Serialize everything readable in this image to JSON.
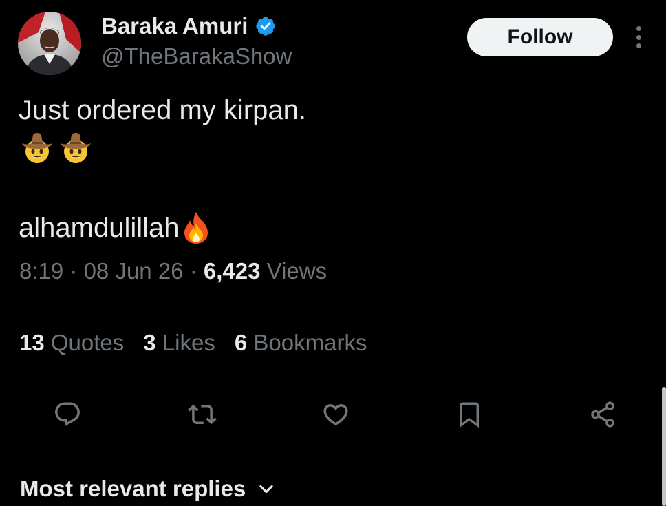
{
  "author": {
    "display_name": "Baraka Amuri",
    "handle": "@TheBarakaShow",
    "verified": true
  },
  "header": {
    "follow_label": "Follow"
  },
  "tweet": {
    "line1": "Just ordered my kirpan.",
    "line3": "alhamdulillah",
    "emojis": [
      "cowboy-face",
      "cowboy-face",
      "fire"
    ]
  },
  "meta": {
    "time": "8:19",
    "sep1": "·",
    "date": "08 Jun 26",
    "sep2": "·",
    "views_count": "6,423",
    "views_label": "Views"
  },
  "stats": [
    {
      "count": "13",
      "label": "Quotes"
    },
    {
      "count": "3",
      "label": "Likes"
    },
    {
      "count": "6",
      "label": "Bookmarks"
    }
  ],
  "actions": [
    "reply-icon",
    "retweet-icon",
    "like-icon",
    "bookmark-icon",
    "share-icon"
  ],
  "replies": {
    "sort_label": "Most relevant replies"
  },
  "colors": {
    "background": "#000000",
    "primary_text": "#e7e9ea",
    "secondary_text": "#71767b",
    "verified_blue": "#1d9bf0",
    "divider": "#2f3336",
    "follow_bg": "#eff3f4"
  }
}
